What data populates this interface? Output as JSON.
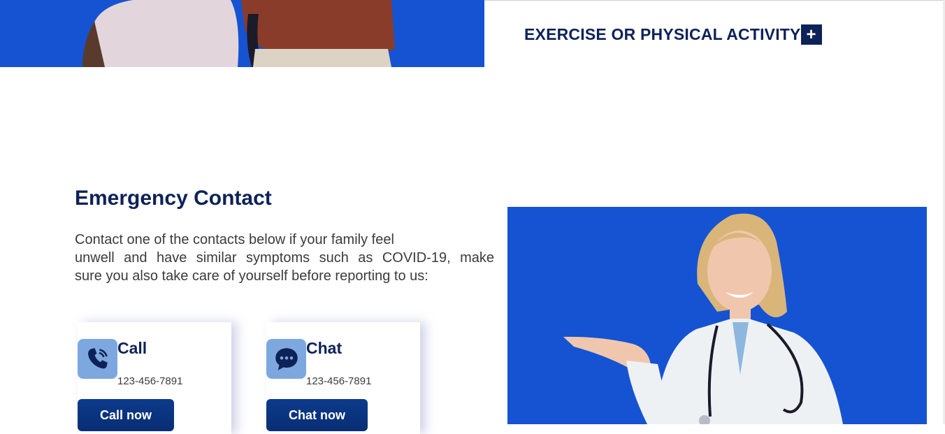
{
  "colors": {
    "brand_blue": "#1553d2",
    "navy": "#0d2258",
    "icon_bg": "#7da8df",
    "button_dark": "#082e74"
  },
  "accordion": {
    "title": "EXERCISE OR PHYSICAL ACTIVITY",
    "toggle_symbol": "+"
  },
  "emergency": {
    "title": "Emergency Contact",
    "description_lines": [
      "Contact one of the contacts below if your family feel",
      "unwell and have similar symptoms such as COVID-19, make",
      "sure you also take care of yourself before reporting to us:"
    ]
  },
  "cards": {
    "call": {
      "icon": "phone-icon",
      "title": "Call",
      "number": "123-456-7891",
      "button": "Call now"
    },
    "chat": {
      "icon": "chat-bubble-icon",
      "title": "Chat",
      "number": "123-456-7891",
      "button": "Chat now"
    }
  }
}
